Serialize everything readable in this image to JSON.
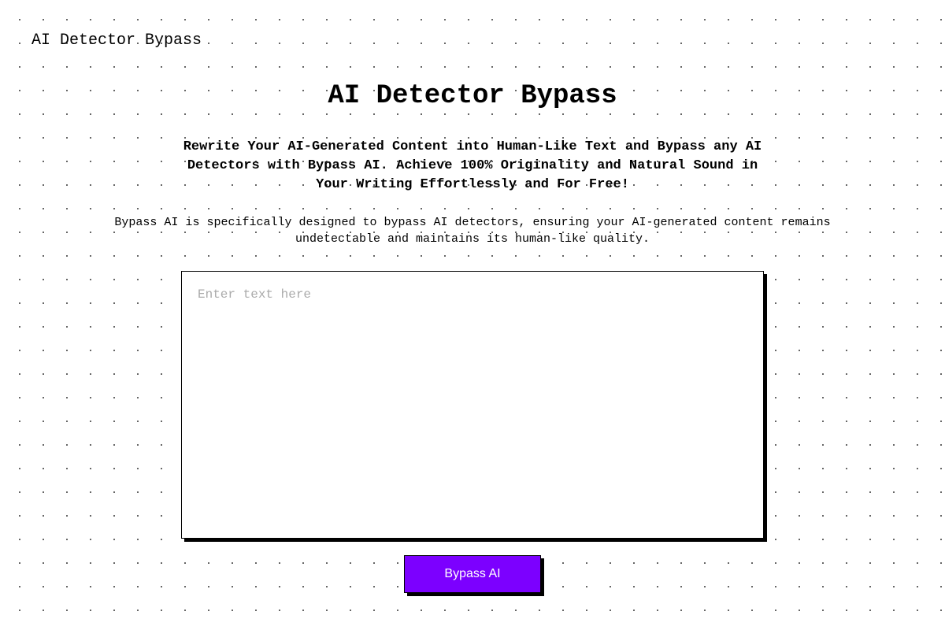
{
  "header": {
    "brand": "AI Detector Bypass"
  },
  "main": {
    "title": "AI Detector Bypass",
    "subtitle": "Rewrite Your AI-Generated Content into Human-Like Text and Bypass any AI Detectors with Bypass AI. Achieve 100% Originality and Natural Sound in Your Writing Effortlessly and For Free!",
    "description": "Bypass AI is specifically designed to bypass AI detectors, ensuring your AI-generated content remains undetectable and maintains its human-like quality.",
    "textarea": {
      "placeholder": "Enter text here",
      "value": ""
    },
    "button": {
      "label": "Bypass AI"
    }
  },
  "colors": {
    "primary": "#7c00ff",
    "text": "#000000",
    "background": "#ffffff"
  }
}
